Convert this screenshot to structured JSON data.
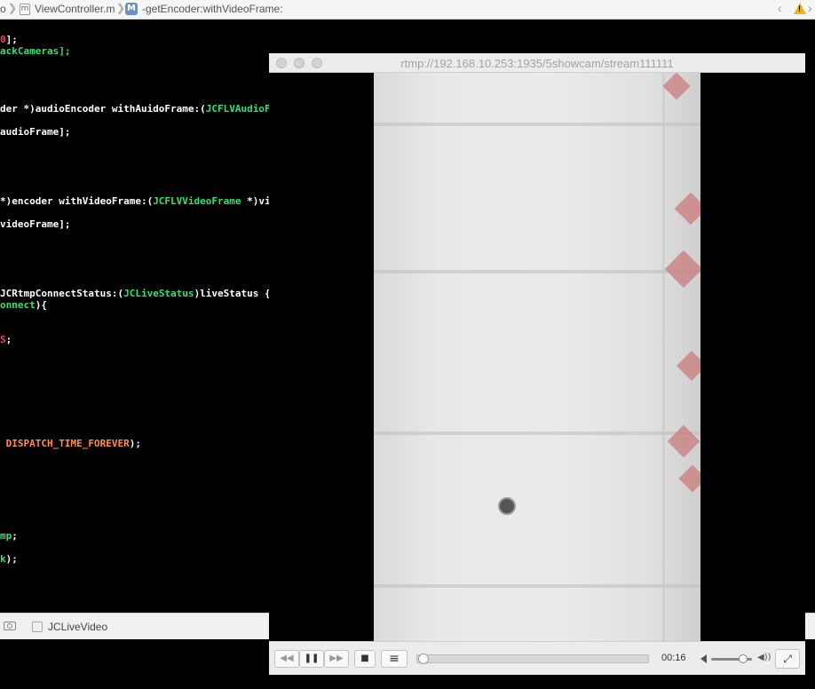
{
  "jumpbar": {
    "crumb_prev": "o",
    "file_icon_letter": "m",
    "file": "ViewController.m",
    "method_icon_letter": "M",
    "method": "-getEncoder:withVideoFrame:"
  },
  "code": [
    {
      "parts": [
        {
          "t": "0",
          "c": "red"
        },
        {
          "t": "];",
          "c": "white"
        }
      ]
    },
    {
      "parts": [
        {
          "t": "ackCameras];",
          "c": "green"
        }
      ]
    },
    {
      "parts": [
        {
          "t": "der *)audioEncoder withAuidoFrame:(",
          "c": "white"
        },
        {
          "t": "JCFLVAudioF",
          "c": "green"
        }
      ]
    },
    {
      "parts": [
        {
          "t": "audioFrame];",
          "c": "white"
        }
      ]
    },
    {
      "parts": [
        {
          "t": "*)encoder withVideoFrame:(",
          "c": "white"
        },
        {
          "t": "JCFLVVideoFrame",
          "c": "green"
        },
        {
          "t": " *)vi",
          "c": "white"
        }
      ]
    },
    {
      "parts": [
        {
          "t": "videoFrame];",
          "c": "white"
        }
      ]
    },
    {
      "parts": [
        {
          "t": "JCRtmpConnectStatus:(",
          "c": "white"
        },
        {
          "t": "JCLiveStatus",
          "c": "green"
        },
        {
          "t": ")liveStatus {",
          "c": "white"
        }
      ]
    },
    {
      "parts": [
        {
          "t": "onnect",
          "c": "green"
        },
        {
          "t": "){",
          "c": "white"
        }
      ]
    },
    {
      "parts": [
        {
          "t": "S",
          "c": "red"
        },
        {
          "t": ";",
          "c": "white"
        }
      ]
    },
    {
      "parts": [
        {
          "t": " DISPATCH_TIME_FOREVER",
          "c": "orange"
        },
        {
          "t": ");",
          "c": "white"
        }
      ]
    },
    {
      "parts": [
        {
          "t": "mp",
          "c": "green"
        },
        {
          "t": ";",
          "c": "white"
        }
      ]
    },
    {
      "parts": [
        {
          "t": "k",
          "c": "green"
        },
        {
          "t": ");",
          "c": "white"
        }
      ]
    }
  ],
  "debug": {
    "target": "JCLiveVideo"
  },
  "player": {
    "title": "rtmp://192.168.10.253:1935/5showcam/stream111111",
    "time": "00:16",
    "progress": 0,
    "volume": 0.85,
    "icons": {
      "rewind": "◀◀",
      "pause": "❚❚",
      "forward": "▶▶",
      "stop": "■",
      "playlist": "≡",
      "volume_max": "◀))",
      "fullscreen": "⤢"
    }
  }
}
